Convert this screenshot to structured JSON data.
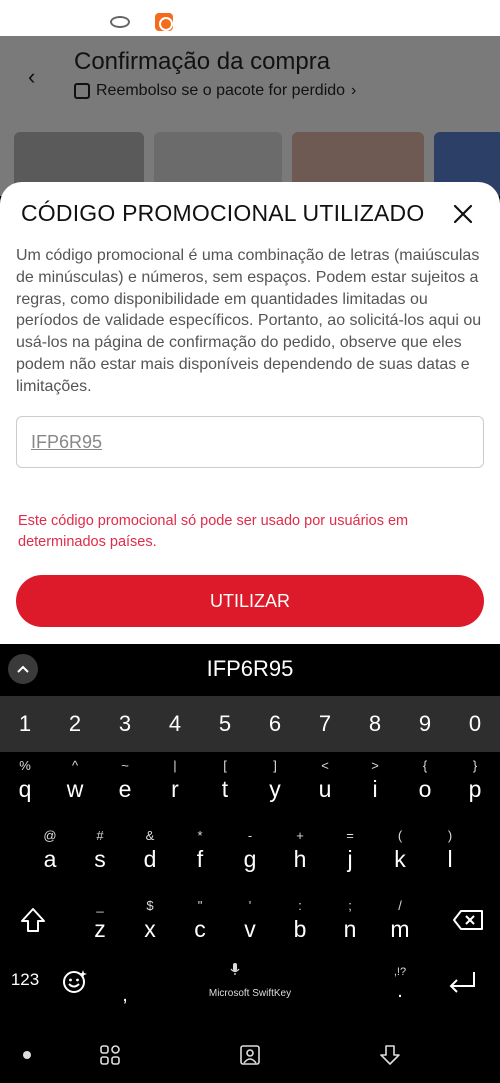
{
  "background_page": {
    "title": "Confirmação da compra",
    "subtitle": "Reembolso se o pacote for perdido",
    "subtitle_chevron": "›",
    "back_icon": "chevron-left-icon"
  },
  "sheet": {
    "title": "CÓDIGO PROMOCIONAL UTILIZADO",
    "close_icon": "close-icon",
    "description": "Um código promocional é uma combinação de letras (maiúsculas de minúsculas) e números, sem espaços. Podem estar sujeitos a regras, como disponibilidade em quantidades limitadas ou períodos de validade específicos. Portanto, ao solicitá-los aqui ou usá-los na página de confirmação do pedido, observe que eles podem não estar mais disponíveis dependendo de suas datas e limitações.",
    "code_value": "IFP6R95",
    "error_message": "Este código promocional só pode ser usado por usuários em determinados países.",
    "submit_label": "UTILIZAR",
    "colors": {
      "primary": "#dc1a2a",
      "error": "#e02b4a"
    }
  },
  "keyboard": {
    "suggestion": "IFP6R95",
    "number_row": [
      "1",
      "2",
      "3",
      "4",
      "5",
      "6",
      "7",
      "8",
      "9",
      "0"
    ],
    "row1": [
      {
        "alt": "%",
        "main": "q"
      },
      {
        "alt": "^",
        "main": "w"
      },
      {
        "alt": "~",
        "main": "e"
      },
      {
        "alt": "|",
        "main": "r"
      },
      {
        "alt": "[",
        "main": "t"
      },
      {
        "alt": "]",
        "main": "y"
      },
      {
        "alt": "<",
        "main": "u"
      },
      {
        "alt": ">",
        "main": "i"
      },
      {
        "alt": "{",
        "main": "o"
      },
      {
        "alt": "}",
        "main": "p"
      }
    ],
    "row2": [
      {
        "alt": "@",
        "main": "a"
      },
      {
        "alt": "#",
        "main": "s"
      },
      {
        "alt": "&",
        "main": "d"
      },
      {
        "alt": "*",
        "main": "f"
      },
      {
        "alt": "-",
        "main": "g"
      },
      {
        "alt": "+",
        "main": "h"
      },
      {
        "alt": "=",
        "main": "j"
      },
      {
        "alt": "(",
        "main": "k"
      },
      {
        "alt": ")",
        "main": "l"
      }
    ],
    "row3": [
      {
        "alt": "_",
        "main": "z"
      },
      {
        "alt": "$",
        "main": "x"
      },
      {
        "alt": "\"",
        "main": "c"
      },
      {
        "alt": "'",
        "main": "v"
      },
      {
        "alt": ":",
        "main": "b"
      },
      {
        "alt": ";",
        "main": "n"
      },
      {
        "alt": "/",
        "main": "m"
      }
    ],
    "symbols_label": "123",
    "comma": ",",
    "space_label": "Microsoft SwiftKey",
    "period_alt": ",!?",
    "period": "."
  }
}
